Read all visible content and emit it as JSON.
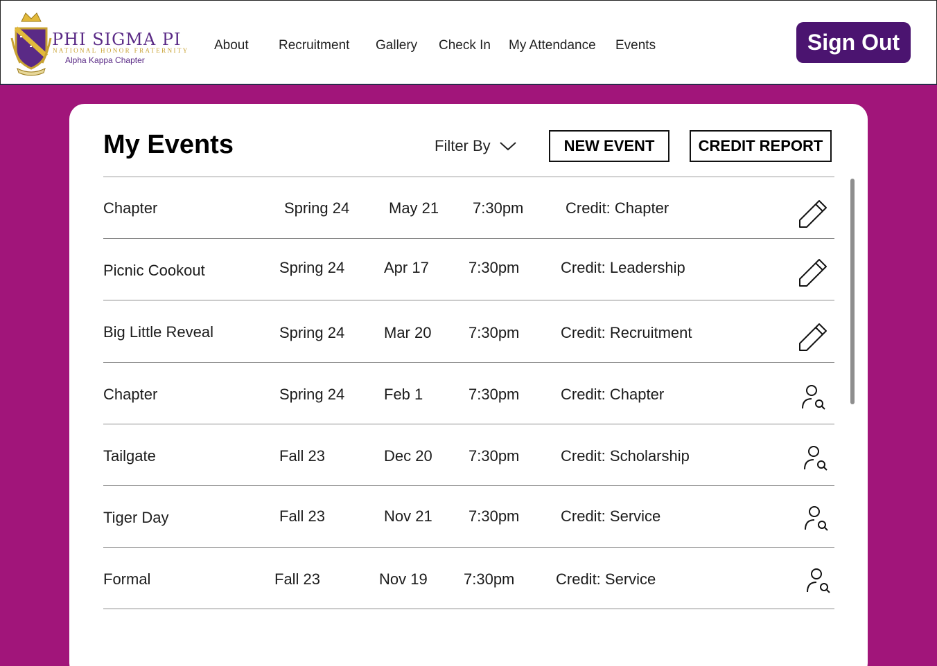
{
  "brand": {
    "name": "PHI SIGMA PI",
    "subtitle": "NATIONAL HONOR FRATERNITY",
    "chapter": "Alpha Kappa Chapter",
    "colors": {
      "purple": "#4b1470",
      "gold": "#c8a232",
      "magenta": "#a1157a"
    }
  },
  "nav": {
    "items": [
      {
        "label": "About"
      },
      {
        "label": "Recruitment"
      },
      {
        "label": "Gallery"
      },
      {
        "label": "Check In"
      },
      {
        "label": "My Attendance"
      },
      {
        "label": "Events"
      }
    ],
    "sign_out_label": "Sign Out"
  },
  "page": {
    "title": "My Events",
    "filter_label": "Filter By",
    "new_event_label": "NEW EVENT",
    "credit_report_label": "CREDIT REPORT"
  },
  "events": [
    {
      "name": "Chapter",
      "term": "Spring 24",
      "date": "May 21",
      "time": "7:30pm",
      "credit": "Credit: Chapter",
      "action_icon": "pencil-icon"
    },
    {
      "name": "Picnic Cookout",
      "term": "Spring 24",
      "date": "Apr 17",
      "time": "7:30pm",
      "credit": "Credit: Leadership",
      "action_icon": "pencil-icon"
    },
    {
      "name": "Big Little Reveal",
      "term": "Spring 24",
      "date": "Mar 20",
      "time": "7:30pm",
      "credit": "Credit: Recruitment",
      "action_icon": "pencil-icon"
    },
    {
      "name": "Chapter",
      "term": "Spring 24",
      "date": "Feb 1",
      "time": "7:30pm",
      "credit": "Credit: Chapter",
      "action_icon": "user-search-icon"
    },
    {
      "name": "Tailgate",
      "term": "Fall 23",
      "date": "Dec 20",
      "time": "7:30pm",
      "credit": "Credit: Scholarship",
      "action_icon": "user-search-icon"
    },
    {
      "name": "Tiger Day",
      "term": "Fall 23",
      "date": "Nov 21",
      "time": "7:30pm",
      "credit": "Credit: Service",
      "action_icon": "user-search-icon"
    },
    {
      "name": "Formal",
      "term": "Fall 23",
      "date": "Nov 19",
      "time": "7:30pm",
      "credit": "Credit: Service",
      "action_icon": "user-search-icon"
    }
  ]
}
